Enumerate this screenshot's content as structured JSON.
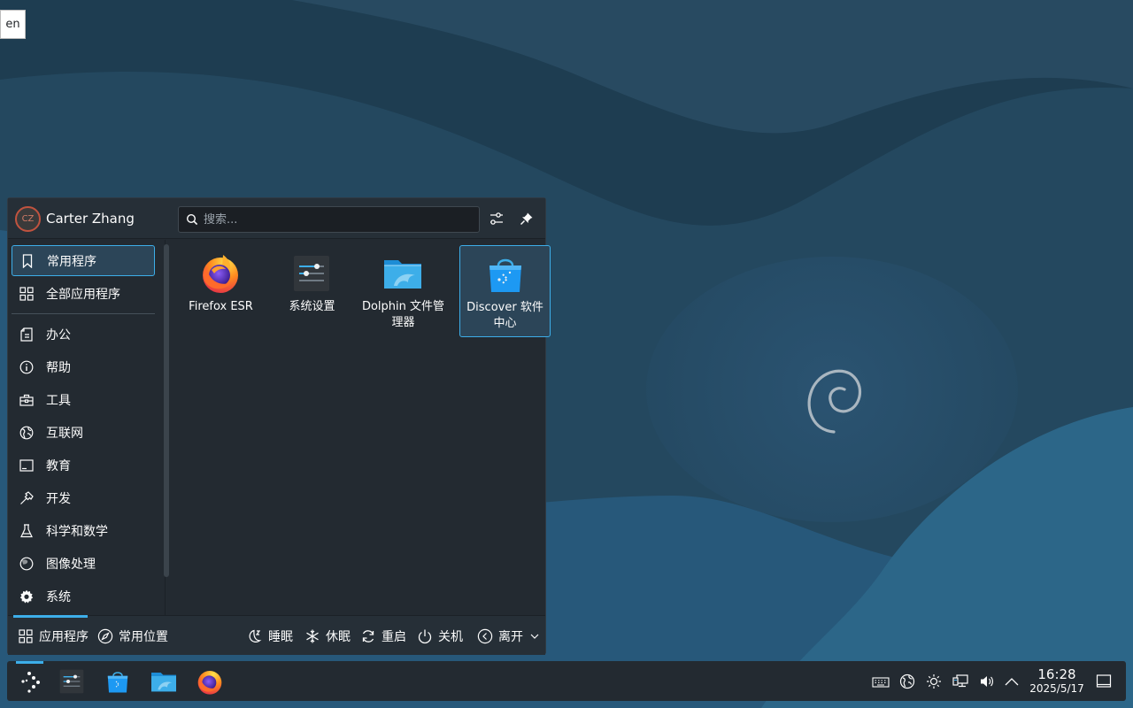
{
  "keyboard_layout": "en",
  "launcher": {
    "user": {
      "initials": "CZ",
      "name": "Carter Zhang"
    },
    "search": {
      "placeholder": "搜索..."
    },
    "header_buttons": [
      "configure-icon",
      "pin-icon"
    ],
    "sidebar": {
      "items": [
        {
          "label": "常用程序",
          "icon": "bookmark-icon",
          "active": true
        },
        {
          "label": "全部应用程序",
          "icon": "grid-icon"
        },
        {
          "label": "办公",
          "icon": "office-icon"
        },
        {
          "label": "帮助",
          "icon": "info-icon"
        },
        {
          "label": "工具",
          "icon": "toolbox-icon"
        },
        {
          "label": "互联网",
          "icon": "globe-icon"
        },
        {
          "label": "教育",
          "icon": "education-icon"
        },
        {
          "label": "开发",
          "icon": "hammer-icon"
        },
        {
          "label": "科学和数学",
          "icon": "flask-icon"
        },
        {
          "label": "图像处理",
          "icon": "graphics-icon"
        },
        {
          "label": "系统",
          "icon": "gear-icon"
        }
      ]
    },
    "apps": [
      {
        "label": "Firefox ESR",
        "icon": "firefox-icon"
      },
      {
        "label": "系统设置",
        "icon": "system-settings-icon"
      },
      {
        "label": "Dolphin 文件管理器",
        "icon": "dolphin-folder-icon"
      },
      {
        "label": "Discover 软件中心",
        "icon": "discover-icon",
        "selected": true
      }
    ],
    "footer": {
      "tabs": [
        {
          "label": "应用程序",
          "icon": "grid-icon",
          "active": true
        },
        {
          "label": "常用位置",
          "icon": "compass-icon"
        }
      ],
      "actions": [
        {
          "label": "睡眠",
          "icon": "sleep-icon"
        },
        {
          "label": "休眠",
          "icon": "hibernate-icon"
        },
        {
          "label": "重启",
          "icon": "restart-icon"
        },
        {
          "label": "关机",
          "icon": "power-icon"
        },
        {
          "label": "离开",
          "icon": "leave-icon"
        }
      ]
    }
  },
  "panel": {
    "tasks": [
      "system-settings-icon",
      "discover-icon",
      "dolphin-folder-icon",
      "firefox-icon"
    ],
    "tray": [
      "keyboard-icon",
      "network-globe-icon",
      "brightness-icon",
      "wired-network-icon",
      "volume-icon",
      "expand-tray-icon"
    ],
    "clock": {
      "time": "16:28",
      "date": "2025/5/17"
    }
  },
  "colors": {
    "accent": "#3daee9",
    "panel_bg": "#232a31",
    "wallpaper_dark": "#1f3b4f",
    "wallpaper_light": "#2c6488"
  }
}
